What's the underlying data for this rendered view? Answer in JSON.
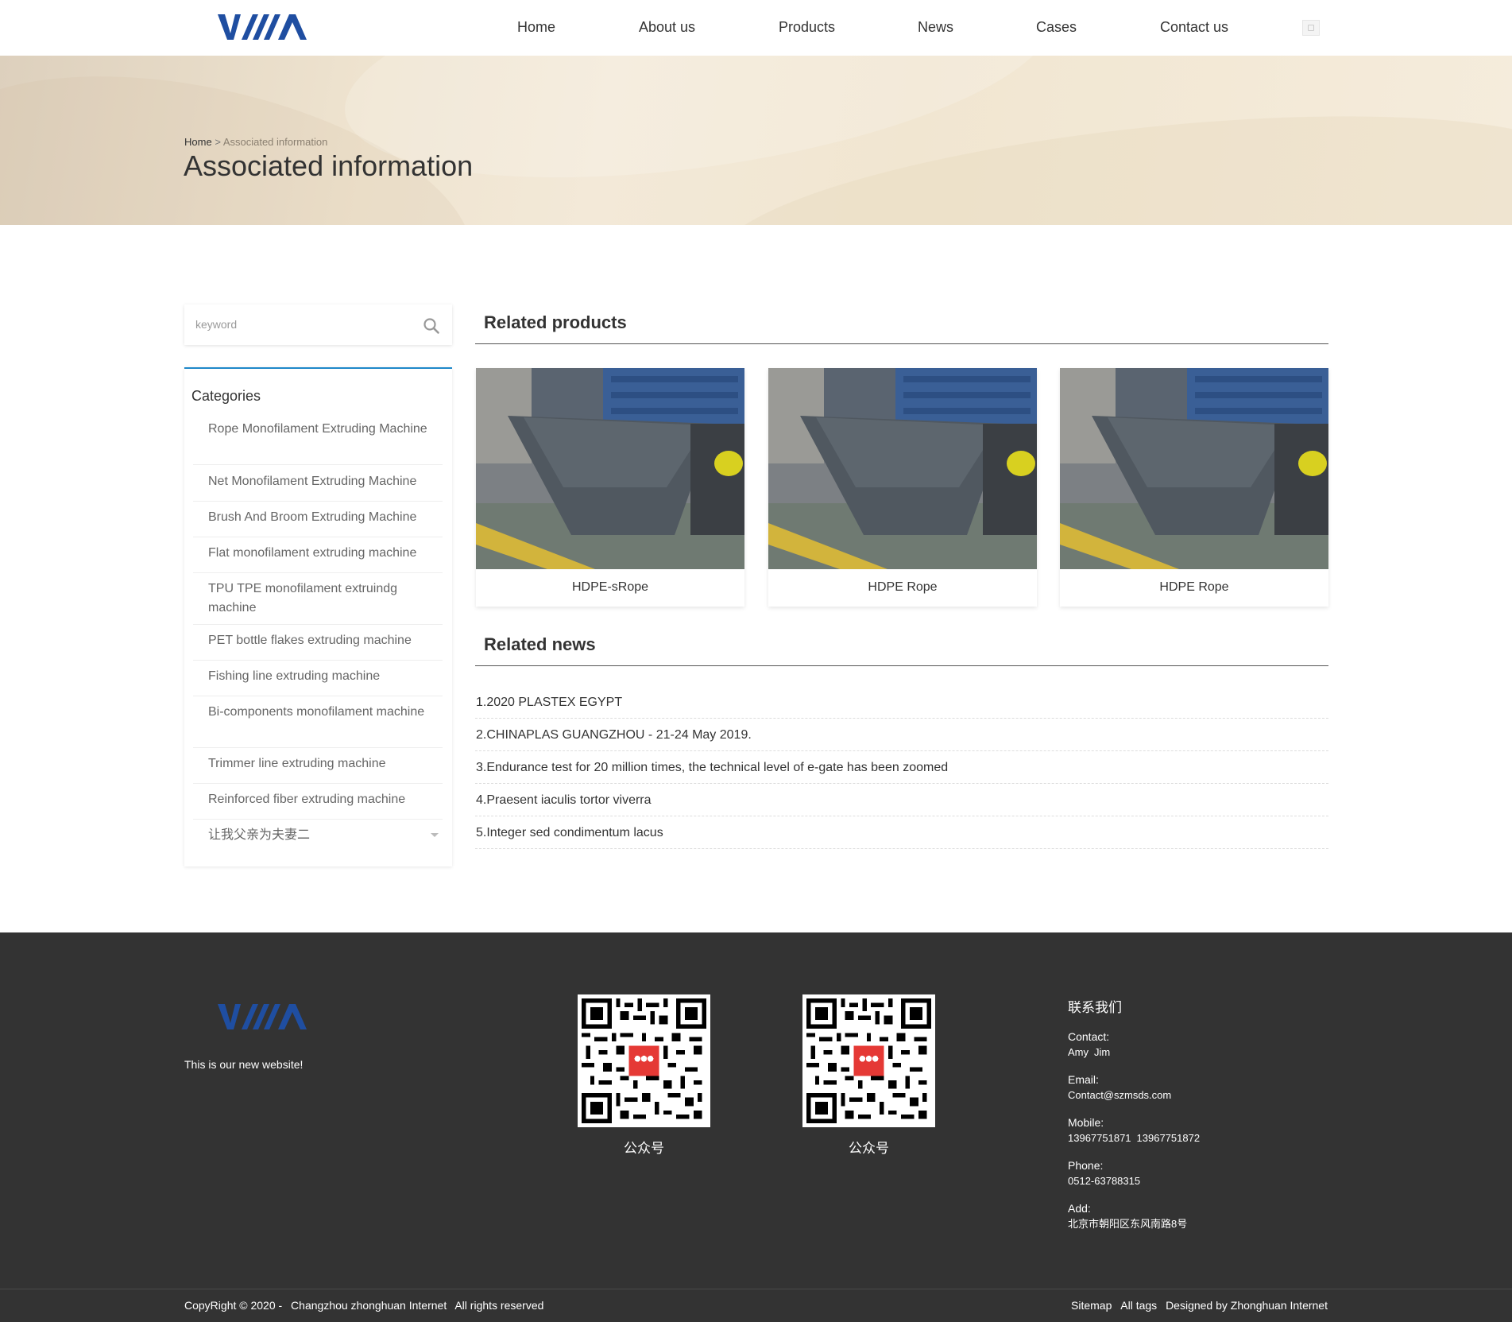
{
  "header": {
    "logo_text": "YWM",
    "nav": [
      "Home",
      "About us",
      "Products",
      "News",
      "Cases",
      "Contact us"
    ],
    "search_icon": "search-icon"
  },
  "banner": {
    "breadcrumb_home": "Home",
    "breadcrumb_sep": ">",
    "breadcrumb_current": "Associated information",
    "title": "Associated information"
  },
  "sidebar": {
    "search_placeholder": "keyword",
    "categories_title": "Categories",
    "categories": [
      "Rope Monofilament Extruding Machine",
      "Net Monofilament Extruding Machine",
      "Brush And Broom Extruding Machine",
      "Flat monofilament extruding machine",
      "TPU TPE monofilament extruindg machine",
      "PET bottle flakes extruding machine",
      "Fishing line extruding machine",
      "Bi-components monofilament machine",
      "Trimmer line extruding machine",
      "Reinforced fiber extruding machine",
      "让我父亲为夫妻二"
    ]
  },
  "related_products": {
    "title": "Related products",
    "items": [
      "HDPE-sRope",
      "HDPE Rope",
      "HDPE Rope"
    ]
  },
  "related_news": {
    "title": "Related news",
    "items": [
      "1.2020 PLASTEX EGYPT",
      "2.CHINAPLAS GUANGZHOU - 21-24 May 2019.",
      "3.Endurance test for 20 million times, the technical level of e-gate has been zoomed",
      "4.Praesent iaculis tortor viverra",
      "5.Integer sed condimentum lacus"
    ]
  },
  "footer": {
    "tagline": "This is our new website!",
    "qr_captions": [
      "公众号",
      "公众号"
    ],
    "contact_title": "联系我们",
    "contact_label": "Contact:",
    "contact_names": [
      "Amy",
      "Jim"
    ],
    "email_label": "Email:",
    "email": "Contact@szmsds.com",
    "mobile_label": "Mobile:",
    "mobiles": [
      "13967751871",
      "13967751872"
    ],
    "phone_label": "Phone:",
    "phone": "0512-63788315",
    "add_label": "Add:",
    "address": "北京市朝阳区东风南路8号",
    "copyright": "CopyRight © 2020 -",
    "company": "Changzhou zhonghuan Internet",
    "rights": "All rights reserved",
    "links": [
      "Sitemap",
      "All tags",
      "Designed by Zhonghuan Internet"
    ]
  },
  "colors": {
    "accent": "#1e88c9",
    "logo_blue": "#1f4ea1",
    "footer_bg": "#333333"
  }
}
